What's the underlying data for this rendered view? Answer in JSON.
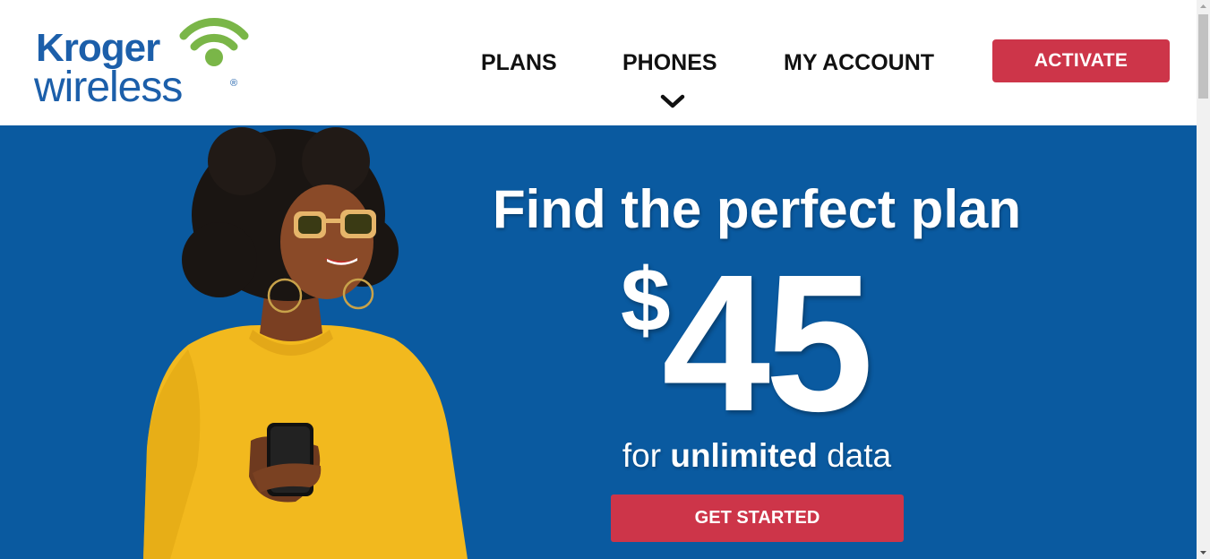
{
  "colors": {
    "brand_blue": "#1c5faa",
    "brand_green": "#7ab648",
    "hero_blue": "#0a5aa0",
    "cta_red": "#cd3549",
    "nav_text": "#111111",
    "sweater_yellow": "#f2b91e"
  },
  "header": {
    "logo": {
      "word1": "Kroger",
      "word2": "wireless",
      "registered": "®",
      "icon": "wifi-icon"
    },
    "nav": {
      "items": [
        {
          "label": "PLANS"
        },
        {
          "label": "PHONES",
          "icon": "chevron-down-icon"
        },
        {
          "label": "MY ACCOUNT"
        }
      ]
    },
    "activate_label": "ACTIVATE"
  },
  "hero": {
    "headline": "Find the perfect plan",
    "price": {
      "currency": "$",
      "amount": "45"
    },
    "subline": {
      "pre": "for ",
      "emphasis": "unlimited",
      "post": " data"
    },
    "cta_label": "GET STARTED",
    "image": "woman-smiling-with-phone-photo"
  }
}
